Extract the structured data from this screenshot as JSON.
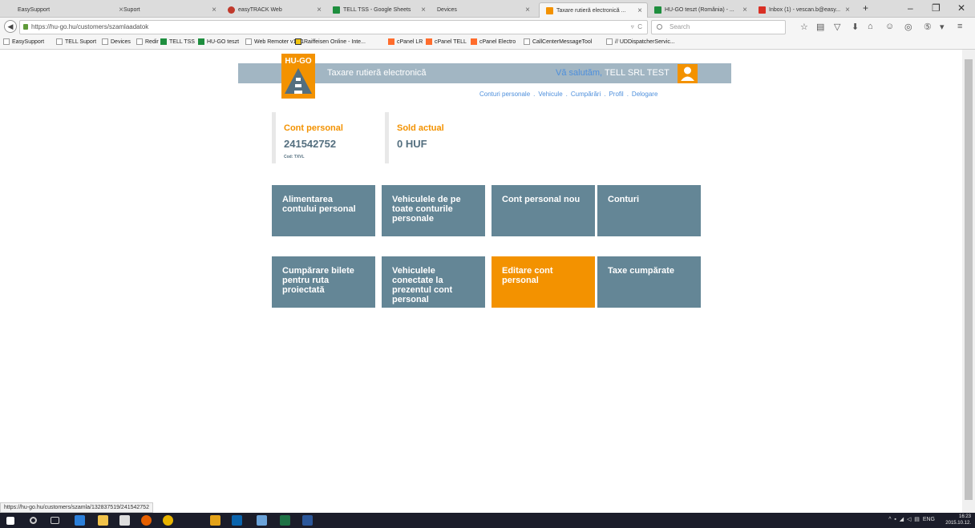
{
  "browser": {
    "tabs": [
      {
        "label": "EasySupport"
      },
      {
        "label": "Suport"
      },
      {
        "label": "easyTRACK Web"
      },
      {
        "label": "TELL TSS - Google Sheets"
      },
      {
        "label": "Devices"
      },
      {
        "label": "Taxare rutieră electronică ..."
      },
      {
        "label": "HU-GO teszt (România) - ..."
      },
      {
        "label": "Inbox (1) - vescan.b@easy..."
      }
    ],
    "url_host": "https://hu-go.hu",
    "url_path": "/customers/szamlaadatok",
    "search_placeholder": "Search",
    "bookmarks": [
      "EasySupport",
      "TELL Suport",
      "Devices",
      "Redir",
      "TELL TSS",
      "HU-GO teszt",
      "Web Remoter v1.41",
      "Raiffeisen Online - Inte...",
      "cPanel LR",
      "cPanel TELL",
      "cPanel Electro",
      "CallCenterMessageTool",
      "// UDDispatcherServic..."
    ],
    "status_url": "https://hu-go.hu/customers/szamla/132837519/241542752"
  },
  "site": {
    "logo_text": "HU-GO",
    "title": "Taxare rutieră electronică",
    "greeting": "Vă salutăm,",
    "user_name": "TELL SRL TEST",
    "menu": [
      "Conturi personale",
      "Vehicule",
      "Cumpărări",
      "Profil",
      "Delogare"
    ]
  },
  "account": {
    "label": "Cont personal",
    "number": "241542752",
    "code": "Cod: TXVL",
    "balance_label": "Sold actual",
    "balance": "0 HUF"
  },
  "tiles": [
    {
      "label": "Alimentarea contului personal"
    },
    {
      "label": "Vehiculele de pe toate conturile personale"
    },
    {
      "label": "Cont personal nou"
    },
    {
      "label": "Conturi"
    },
    {
      "label": "Cumpărare bilete pentru ruta proiectată"
    },
    {
      "label": "Vehiculele conectate la prezentul cont personal"
    },
    {
      "label": "Editare cont personal"
    },
    {
      "label": "Taxe cumpărate"
    }
  ],
  "taskbar": {
    "lang": "ENG",
    "time": "16:23",
    "date": "2015.10.12."
  },
  "colors": {
    "tile": "#648696",
    "accent": "#f39200",
    "header": "#a2b6c3",
    "link": "#4d8fdc"
  }
}
